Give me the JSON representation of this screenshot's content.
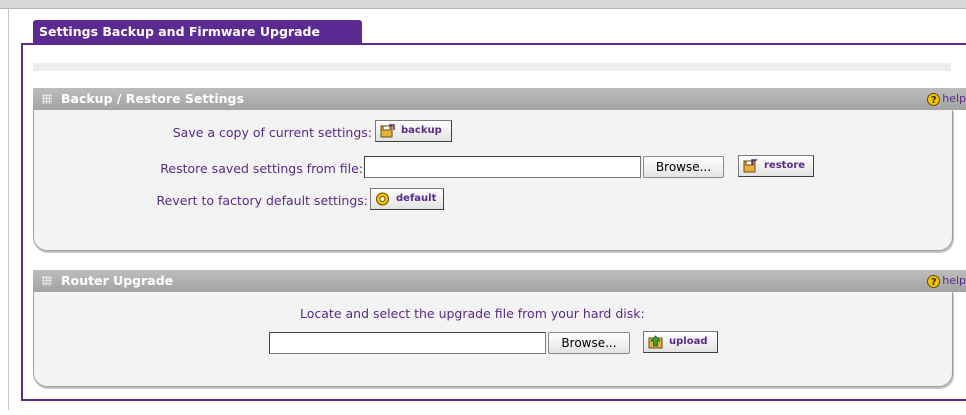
{
  "page": {
    "tab_label": "Settings Backup and Firmware Upgrade"
  },
  "backup_section": {
    "title": "Backup / Restore Settings",
    "help_label": "help",
    "save_label": "Save a copy of current settings:",
    "backup_button": "backup",
    "restore_label": "Restore saved settings from file:",
    "restore_file_value": "",
    "browse_button": "Browse...",
    "restore_button": "restore",
    "revert_label": "Revert to factory default settings:",
    "default_button": "default"
  },
  "upgrade_section": {
    "title": "Router Upgrade",
    "help_label": "help",
    "locate_label": "Locate and select the upgrade file from your hard disk:",
    "upgrade_file_value": "",
    "browse_button": "Browse...",
    "upload_button": "upload"
  },
  "colors": {
    "accent": "#5c2a93",
    "section_bar": "#afafaf",
    "label_text": "#5a2a8a"
  }
}
